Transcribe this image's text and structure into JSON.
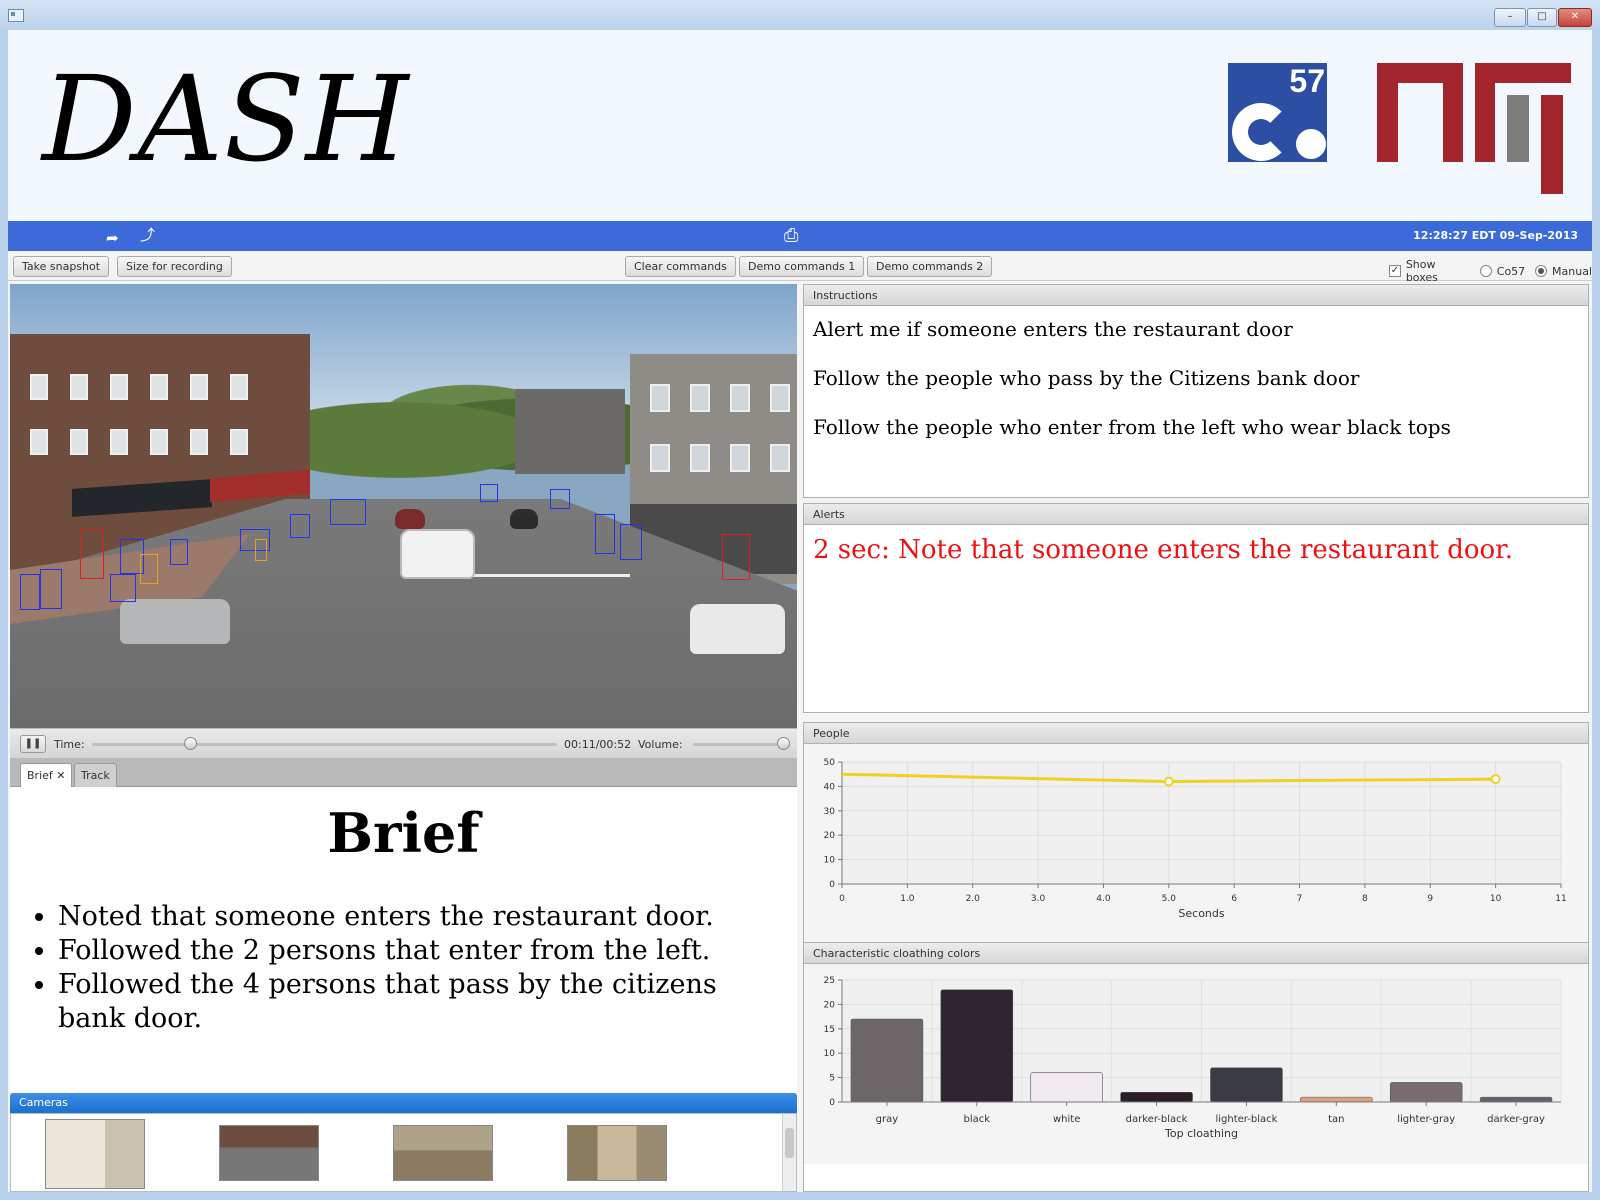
{
  "header": {
    "title": "DASH",
    "logos": [
      {
        "name": "co57-logo",
        "text": "57"
      },
      {
        "name": "mit-logo",
        "text": "MIT"
      }
    ]
  },
  "bluebar": {
    "timestamp": "12:28:27 EDT 09-Sep-2013",
    "accent": "#3d6ad9"
  },
  "toolbar": {
    "take_snapshot": "Take snapshot",
    "size_for_recording": "Size for recording",
    "clear_commands": "Clear commands",
    "demo_commands_1": "Demo commands 1",
    "demo_commands_2": "Demo commands 2",
    "show_boxes": "Show boxes",
    "show_boxes_checked": true,
    "radio_co57": "Co57",
    "radio_manual": "Manual",
    "radio_selected": "Manual"
  },
  "media": {
    "time_label": "Time:",
    "time_value": "00:11/00:52",
    "volume_label": "Volume:",
    "progress": 0.21,
    "volume": 1.0
  },
  "tabs": [
    {
      "label": "Brief",
      "closable": true,
      "active": true
    },
    {
      "label": "Track",
      "closable": false,
      "active": false
    }
  ],
  "brief": {
    "heading": "Brief",
    "items": [
      "Noted that someone enters the restaurant door.",
      "Followed the 2 persons that enter from the left.",
      "Followed the 4 persons that pass by the citizens bank door."
    ]
  },
  "cameras": {
    "header": "Cameras",
    "count": 4
  },
  "panels": {
    "instructions": {
      "title": "Instructions",
      "lines": [
        "Alert me if someone enters the restaurant door",
        "Follow the people who pass by the Citizens bank door",
        "Follow the people who enter from the left who wear black tops"
      ]
    },
    "alerts": {
      "title": "Alerts",
      "text": "2 sec: Note that someone enters the restaurant door.",
      "color": "#e11111"
    },
    "people": {
      "title": "People"
    },
    "clothing": {
      "title": "Characteristic cloathing colors"
    }
  },
  "chart_data": [
    {
      "type": "line",
      "title": "",
      "xlabel": "Seconds",
      "ylabel": "",
      "xlim": [
        0,
        11
      ],
      "ylim": [
        0,
        50
      ],
      "x_ticks": [
        "0",
        "1.0",
        "2.0",
        "3.0",
        "4.0",
        "5.0",
        "6",
        "7",
        "8",
        "9",
        "10",
        "11"
      ],
      "y_ticks": [
        "0",
        "10",
        "20",
        "30",
        "40",
        "50"
      ],
      "x": [
        0,
        5,
        10
      ],
      "y": [
        45,
        42,
        43
      ],
      "color": "#f0d020",
      "grid": true
    },
    {
      "type": "bar",
      "title": "",
      "xlabel": "Top cloathing",
      "ylabel": "",
      "ylim": [
        0,
        25
      ],
      "y_ticks": [
        "0",
        "5",
        "10",
        "15",
        "20",
        "25"
      ],
      "categories": [
        "gray",
        "black",
        "white",
        "darker-black",
        "lighter-black",
        "tan",
        "lighter-gray",
        "darker-gray"
      ],
      "values": [
        17,
        23,
        6,
        2,
        7,
        1,
        4,
        1
      ],
      "colors": [
        "#6d6669",
        "#2e2430",
        "#f1e9f0",
        "#2a1e27",
        "#3b3b44",
        "#d9a27a",
        "#7a6c6e",
        "#62636e"
      ],
      "grid": true
    }
  ]
}
